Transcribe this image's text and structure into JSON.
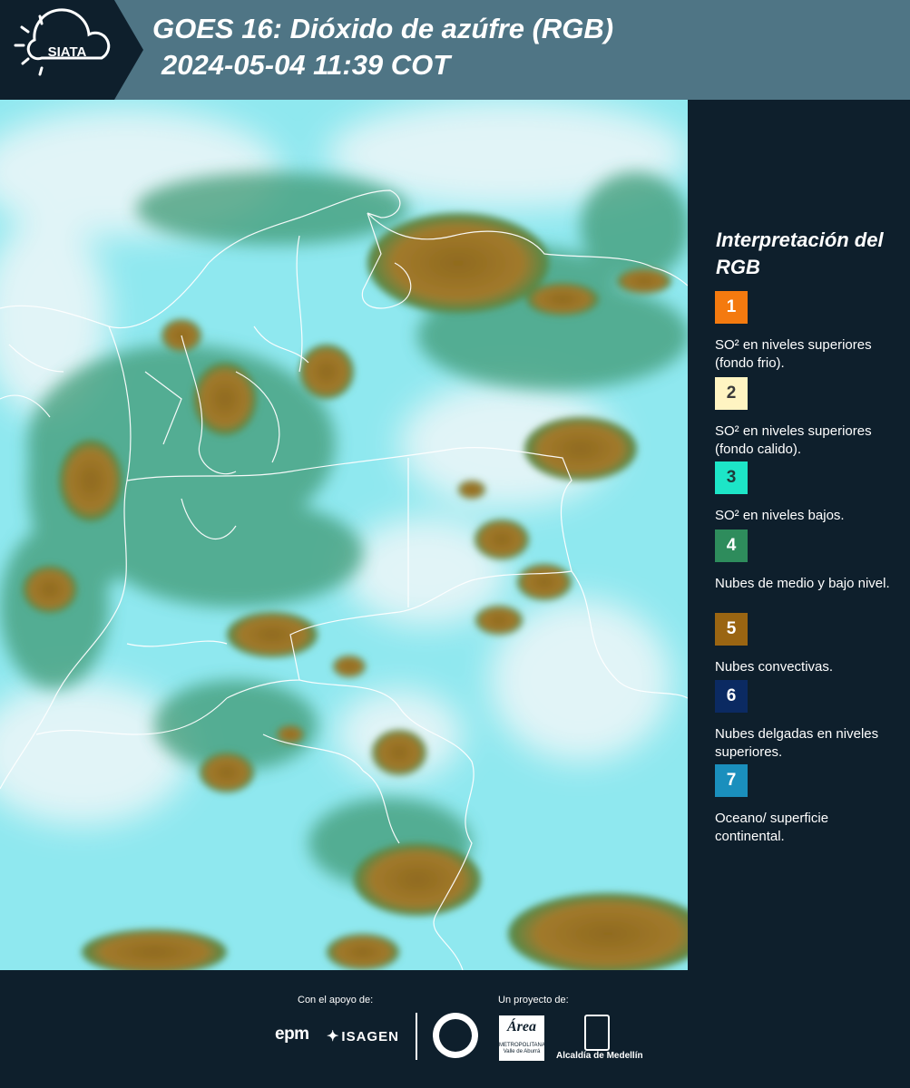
{
  "header": {
    "logo_text": "SIATA",
    "title_line1": "GOES 16: Dióxido de azúfre (RGB)",
    "title_line2": "2024-05-04 11:39 COT"
  },
  "legend": {
    "title": "Interpretación del RGB",
    "items": [
      {
        "number": "1",
        "color": "#f47a0f",
        "text_color": "#ffffff",
        "text": "SO² en niveles superiores (fondo frio)."
      },
      {
        "number": "2",
        "color": "#fff4c2",
        "text_color": "#3a3a3a",
        "text": "SO² en niveles superiores (fondo calido)."
      },
      {
        "number": "3",
        "color": "#1de5c7",
        "text_color": "#1f3a3a",
        "text": "SO² en niveles bajos."
      },
      {
        "number": "4",
        "color": "#2e8c5c",
        "text_color": "#ffffff",
        "text": "Nubes de medio y bajo nivel."
      },
      {
        "number": "5",
        "color": "#9a6512",
        "text_color": "#ffffff",
        "text": "Nubes convectivas."
      },
      {
        "number": "6",
        "color": "#0b2a62",
        "text_color": "#ffffff",
        "text": "Nubes delgadas en niveles superiores."
      },
      {
        "number": "7",
        "color": "#1a8fbd",
        "text_color": "#ffffff",
        "text": "Oceano/ superficie continental."
      }
    ]
  },
  "footer": {
    "support_label": "Con el apoyo de:",
    "project_label": "Un proyecto de:",
    "epm_logo_text": "epm",
    "isagen_logo_text": "ISAGEN",
    "amva_logo_text": "Área",
    "amva_logo_subtext": "METROPOLITANA Valle de Aburrá",
    "alcaldia_text": "Alcaldía de Medellín"
  }
}
